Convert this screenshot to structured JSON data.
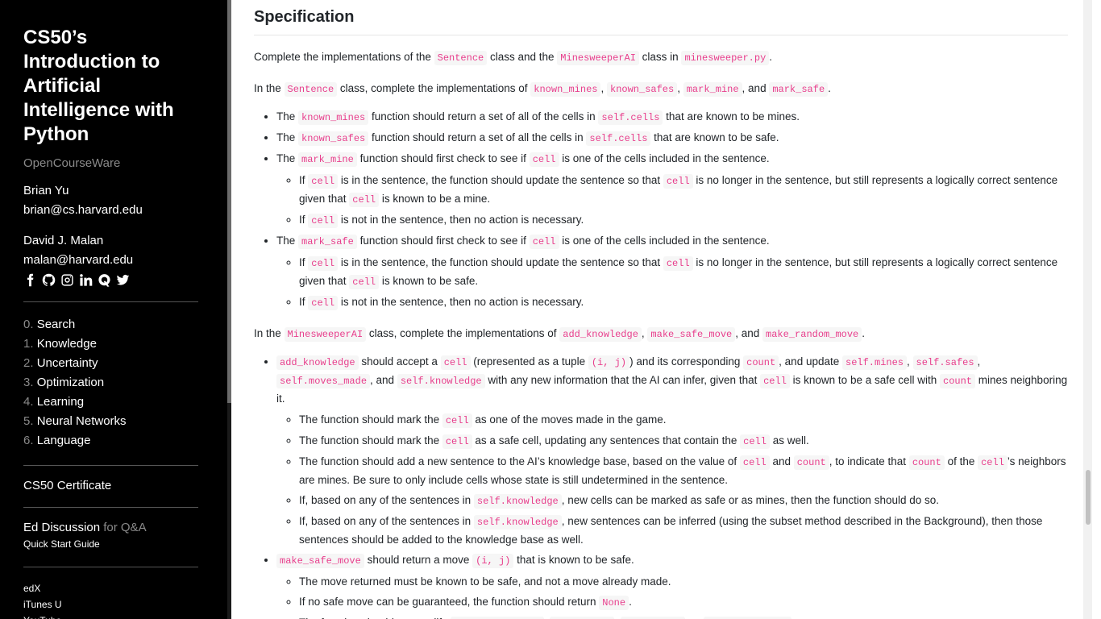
{
  "sidebar": {
    "title": "CS50’s Introduction to Artificial Intelligence with Python",
    "subtitle": "OpenCourseWare",
    "authors": [
      {
        "name": "Brian Yu",
        "email": "brian@cs.harvard.edu"
      },
      {
        "name": "David J. Malan",
        "email": "malan@harvard.edu"
      }
    ],
    "socials": [
      "facebook-icon",
      "github-icon",
      "instagram-icon",
      "linkedin-icon",
      "quora-icon",
      "twitter-icon"
    ],
    "nav": [
      {
        "num": "0.",
        "label": "Search"
      },
      {
        "num": "1.",
        "label": "Knowledge"
      },
      {
        "num": "2.",
        "label": "Uncertainty"
      },
      {
        "num": "3.",
        "label": "Optimization"
      },
      {
        "num": "4.",
        "label": "Learning"
      },
      {
        "num": "5.",
        "label": "Neural Networks"
      },
      {
        "num": "6.",
        "label": "Language"
      }
    ],
    "certificate": "CS50 Certificate",
    "ed": "Ed Discussion",
    "ed_suffix": "for Q&A",
    "quick_start": "Quick Start Guide",
    "platforms": [
      "edX",
      "iTunes U",
      "YouTube"
    ]
  },
  "main": {
    "heading": "Specification",
    "p1": [
      "Complete the implementations of the ",
      "Sentence",
      " class and the ",
      "MinesweeperAI",
      " class in ",
      "minesweeper.py",
      "."
    ],
    "p2": [
      "In the ",
      "Sentence",
      " class, complete the implementations of ",
      "known_mines",
      ", ",
      "known_safes",
      ", ",
      "mark_mine",
      ", and ",
      "mark_safe",
      "."
    ],
    "s1": [
      "The ",
      "known_mines",
      " function should return a set of all of the cells in ",
      "self.cells",
      " that are known to be mines."
    ],
    "s2": [
      "The ",
      "known_safes",
      " function should return a set of all the cells in ",
      "self.cells",
      " that are known to be safe."
    ],
    "s3": [
      "The ",
      "mark_mine",
      " function should first check to see if ",
      "cell",
      " is one of the cells included in the sentence."
    ],
    "s3a": [
      "If ",
      "cell",
      " is in the sentence, the function should update the sentence so that ",
      "cell",
      " is no longer in the sentence, but still represents a logically correct sentence given that ",
      "cell",
      " is known to be a mine."
    ],
    "s3b": [
      "If ",
      "cell",
      " is not in the sentence, then no action is necessary."
    ],
    "s4": [
      "The ",
      "mark_safe",
      " function should first check to see if ",
      "cell",
      " is one of the cells included in the sentence."
    ],
    "s4a": [
      "If ",
      "cell",
      " is in the sentence, the function should update the sentence so that ",
      "cell",
      " is no longer in the sentence, but still represents a logically correct sentence given that ",
      "cell",
      " is known to be safe."
    ],
    "s4b": [
      "If ",
      "cell",
      " is not in the sentence, then no action is necessary."
    ],
    "p3": [
      "In the ",
      "MinesweeperAI",
      " class, complete the implementations of ",
      "add_knowledge",
      ", ",
      "make_safe_move",
      ", and ",
      "make_random_move",
      "."
    ],
    "a1": [
      "",
      "add_knowledge",
      " should accept a ",
      "cell",
      " (represented as a tuple ",
      "(i, j)",
      ") and its corresponding ",
      "count",
      ", and update ",
      "self.mines",
      ", ",
      "self.safes",
      ", ",
      "self.moves_made",
      ", and ",
      "self.knowledge",
      " with any new information that the AI can infer, given that ",
      "cell",
      " is known to be a safe cell with ",
      "count",
      " mines neighboring it."
    ],
    "a1a": [
      "The function should mark the ",
      "cell",
      " as one of the moves made in the game."
    ],
    "a1b": [
      "The function should mark the ",
      "cell",
      " as a safe cell, updating any sentences that contain the ",
      "cell",
      " as well."
    ],
    "a1c": [
      "The function should add a new sentence to the AI’s knowledge base, based on the value of ",
      "cell",
      " and ",
      "count",
      ", to indicate that ",
      "count",
      " of the ",
      "cell",
      "’s neighbors are mines. Be sure to only include cells whose state is still undetermined in the sentence."
    ],
    "a1d": [
      "If, based on any of the sentences in ",
      "self.knowledge",
      ", new cells can be marked as safe or as mines, then the function should do so."
    ],
    "a1e": [
      "If, based on any of the sentences in ",
      "self.knowledge",
      ", new sentences can be inferred (using the subset method described in the Background), then those sentences should be added to the knowledge base as well."
    ],
    "a2": [
      "",
      "make_safe_move",
      " should return a move ",
      "(i, j)",
      " that is known to be safe."
    ],
    "a2a": [
      "The move returned must be known to be safe, and not a move already made."
    ],
    "a2b": [
      "If no safe move can be guaranteed, the function should return ",
      "None",
      "."
    ],
    "a2c": [
      "The function should not modify ",
      "self.moves_made",
      ", ",
      "self.mines",
      ", ",
      "self.safes",
      ", or ",
      "self.knowledge",
      "."
    ]
  }
}
